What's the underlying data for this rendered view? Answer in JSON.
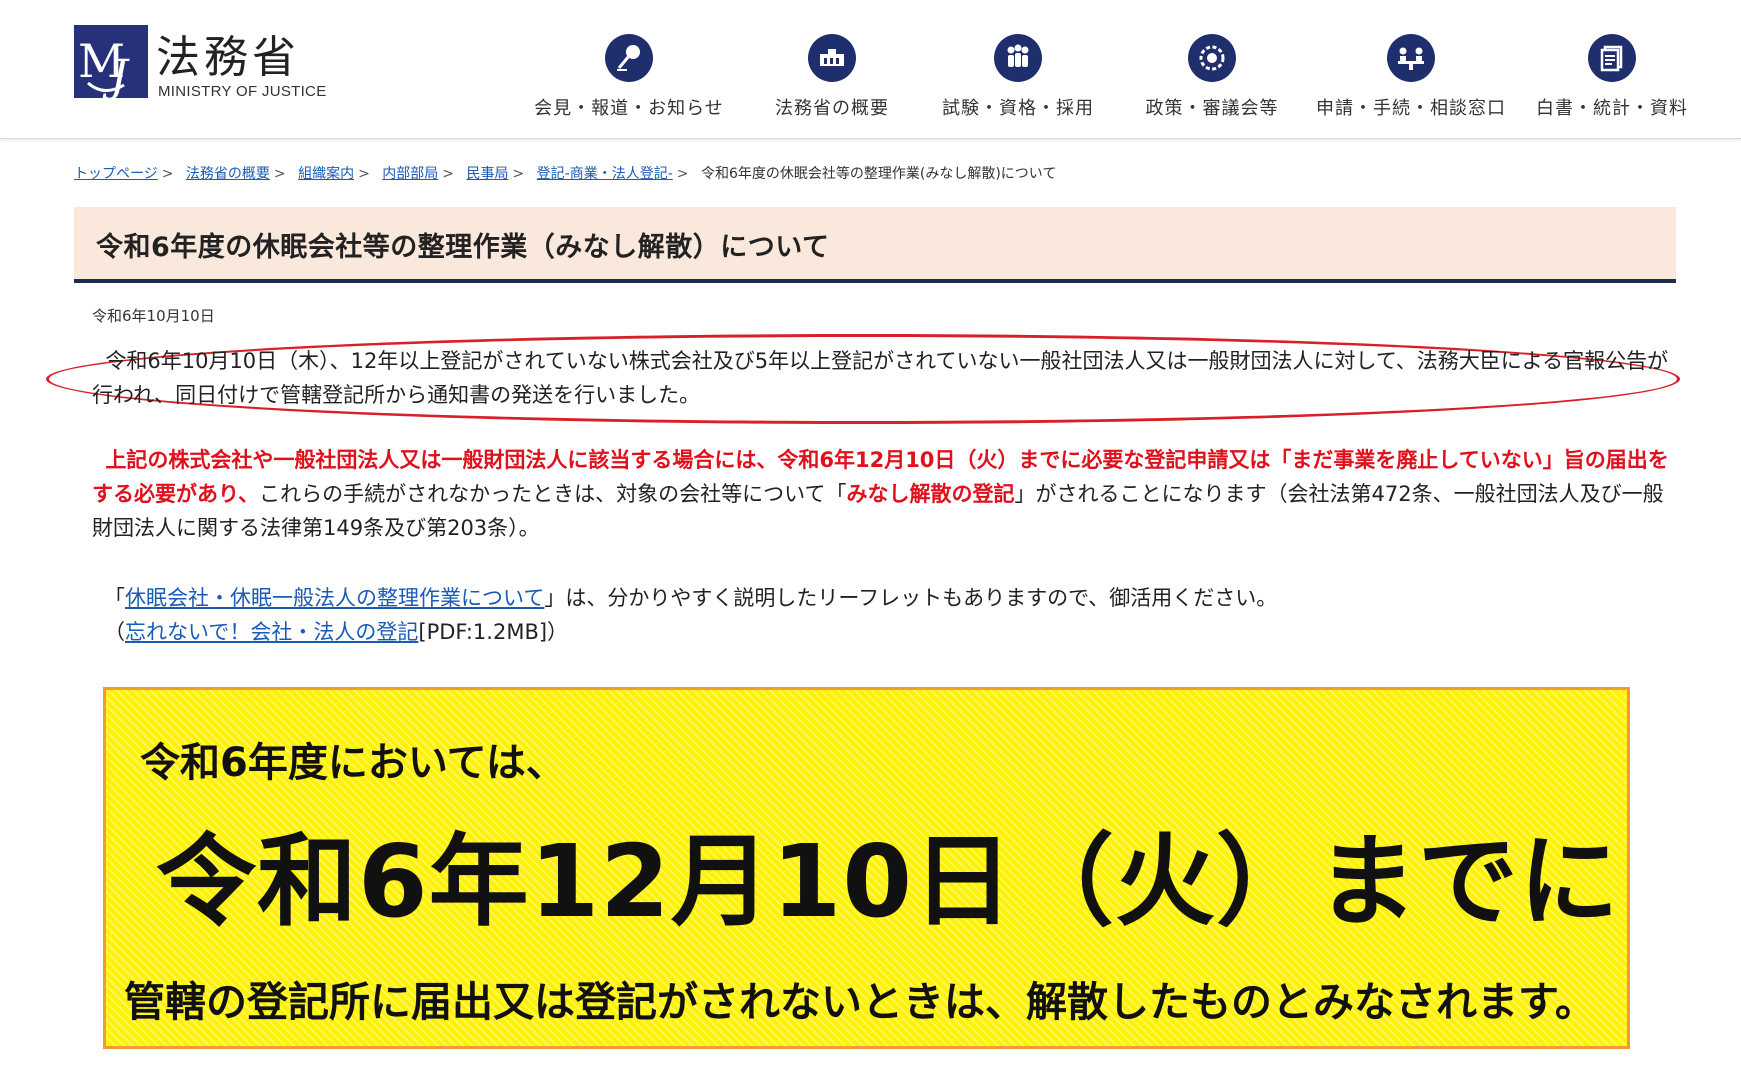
{
  "header": {
    "logo_jp": "法務省",
    "logo_en": "MINISTRY OF JUSTICE",
    "nav": [
      {
        "label": "会見・報道・お知らせ",
        "icon": "microphone-icon"
      },
      {
        "label": "法務省の概要",
        "icon": "building-icon"
      },
      {
        "label": "試験・資格・採用",
        "icon": "people-icon"
      },
      {
        "label": "政策・審議会等",
        "icon": "ring-icon"
      },
      {
        "label": "申請・手続・相談窓口",
        "icon": "consultation-icon"
      },
      {
        "label": "白書・統計・資料",
        "icon": "document-icon"
      }
    ]
  },
  "breadcrumb": {
    "items": [
      "トップページ",
      "法務省の概要",
      "組織案内",
      "内部部局",
      "民事局",
      "登記-商業・法人登記-"
    ],
    "separator": ">",
    "current": "令和6年度の休眠会社等の整理作業(みなし解散)について"
  },
  "page": {
    "title": "令和6年度の休眠会社等の整理作業（みなし解散）について",
    "date": "令和6年10月10日",
    "para1": "令和6年10月10日（木）、12年以上登記がされていない株式会社及び5年以上登記がされていない一般社団法人又は一般財団法人に対して、法務大臣による官報公告が行われ、同日付けで管轄登記所から通知書の発送を行いました。",
    "para2_red1": "上記の株式会社や一般社団法人又は一般財団法人に該当する場合には、令和6年12月10日（火）までに必要な登記申請又は「まだ事業を廃止していない」旨の届出をする必要があり、",
    "para2_mid": "これらの手続がされなかったときは、対象の会社等について「",
    "para2_red2": "みなし解散の登記",
    "para2_end": "」がされることになります（会社法第472条、一般社団法人及び一般財団法人に関する法律第149条及び第203条）。",
    "para3_open": "「",
    "para3_link": "休眠会社・休眠一般法人の整理作業について",
    "para3_after": "」は、分かりやすく説明したリーフレットもありますので、御活用ください。",
    "para4_open": "（",
    "para4_link": "忘れないで！会社・法人の登記",
    "para4_after": "[PDF:1.2MB]）"
  },
  "banner": {
    "line1": "令和6年度においては、",
    "line2": "令和6年12月10日（火）までに",
    "line3": "管轄の登記所に届出又は登記がされないときは、解散したものとみなされます。"
  },
  "colors": {
    "navy": "#1f2f6e",
    "accent_red": "#e0101c",
    "banner_yellow": "#fff200",
    "banner_border": "#f29a37",
    "title_bg": "#fbe8dd"
  }
}
